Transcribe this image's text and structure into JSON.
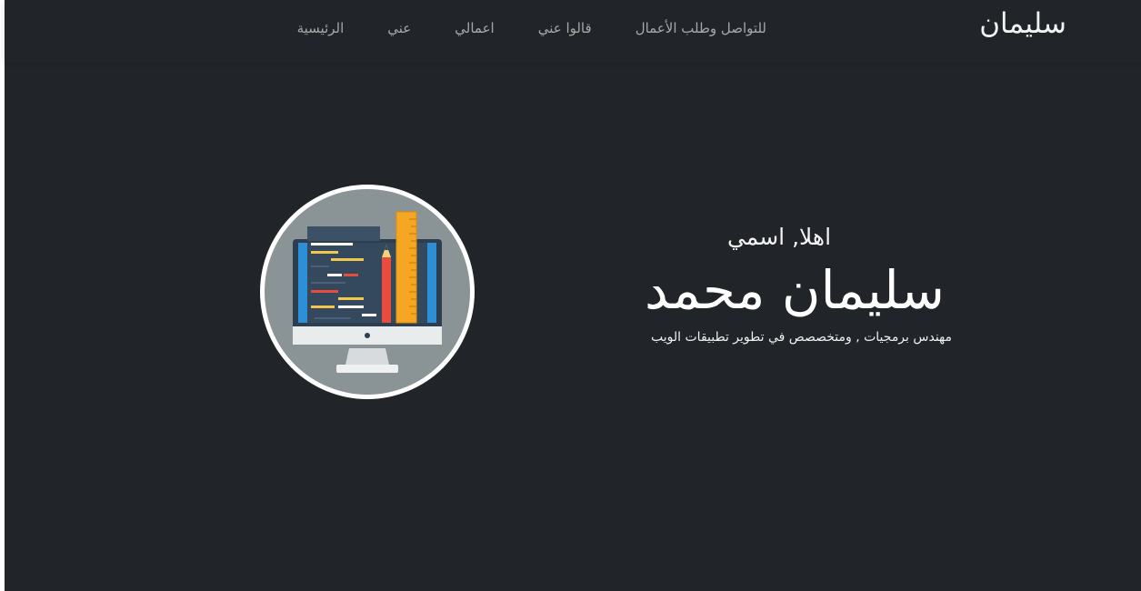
{
  "nav": {
    "brand": "سليمان",
    "links": [
      {
        "label": "الرئيسية"
      },
      {
        "label": "عني"
      },
      {
        "label": "اعمالي"
      },
      {
        "label": "قالوا عني"
      },
      {
        "label": "للتواصل وطلب الأعمال"
      }
    ]
  },
  "hero": {
    "greeting": "اهلا, اسمي",
    "name": "سليمان محمد",
    "subtitle": "مهندس برمجيات , ومتخصصص في تطوير تطبيقات الويب",
    "image_icon": "computer-code-illustration-icon"
  },
  "colors": {
    "background": "#212428",
    "text": "#ffffff",
    "nav_text": "#a8a8a8",
    "circle_fill": "#8a9396"
  }
}
